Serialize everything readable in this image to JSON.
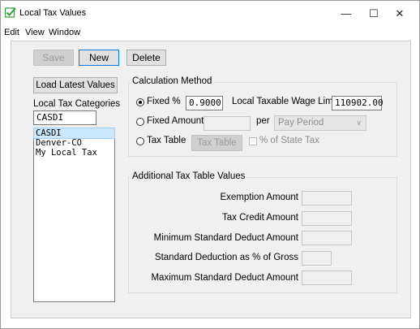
{
  "window": {
    "title": "Local Tax Values",
    "minimize_glyph": "—",
    "maximize_glyph": "☐",
    "close_glyph": "✕",
    "icon": "app-check-icon"
  },
  "menu": [
    "Edit",
    "View",
    "Window"
  ],
  "toolbar": {
    "save_label": "Save",
    "new_label": "New",
    "delete_label": "Delete"
  },
  "sidebar": {
    "load_button": "Load Latest Values",
    "categories_label": "Local Tax Categories",
    "filter_value": "CASDI",
    "items": [
      "CASDI",
      "Denver-CO",
      "My Local Tax"
    ],
    "selected_index": 0
  },
  "calc": {
    "group_title": "Calculation Method",
    "fixed_pct_label": "Fixed %",
    "fixed_pct_value": "0.9000",
    "wage_limit_label": "Local Taxable Wage Limit",
    "wage_limit_value": "110902.00",
    "fixed_amount_label": "Fixed Amount",
    "fixed_amount_value": "",
    "per_label": "per",
    "period_value": "Pay Period",
    "tax_table_label": "Tax Table",
    "tax_table_button": "Tax Table",
    "pct_state_label": "% of State Tax",
    "selected_method": "Fixed %"
  },
  "additional": {
    "group_title": "Additional Tax Table Values",
    "fields": [
      {
        "label": "Exemption Amount",
        "value": ""
      },
      {
        "label": "Tax Credit Amount",
        "value": ""
      },
      {
        "label": "Minimum Standard Deduct Amount",
        "value": ""
      },
      {
        "label": "Standard Deduction as % of Gross",
        "value": ""
      },
      {
        "label": "Maximum Standard Deduct Amount",
        "value": ""
      }
    ]
  },
  "colors": {
    "accent": "#0078d7",
    "selection": "#cce8ff",
    "app_icon_green": "#2e9d3a"
  }
}
